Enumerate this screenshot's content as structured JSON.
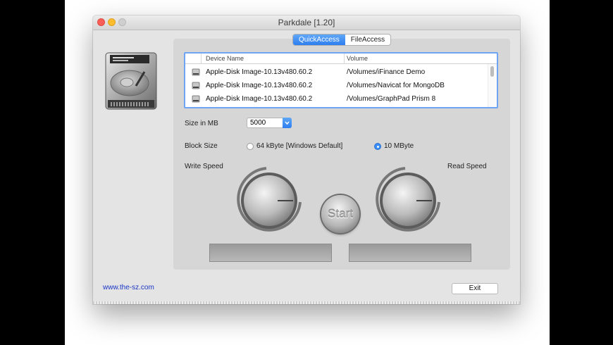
{
  "window": {
    "title": "Parkdale [1.20]",
    "tabs": [
      {
        "label": "QuickAccess",
        "active": true
      },
      {
        "label": "FileAccess",
        "active": false
      }
    ]
  },
  "devices": {
    "columns": [
      "Device Name",
      "Volume"
    ],
    "rows": [
      {
        "name": "Apple-Disk Image-10.13v480.60.2",
        "volume": "/Volumes/iFinance Demo"
      },
      {
        "name": "Apple-Disk Image-10.13v480.60.2",
        "volume": "/Volumes/Navicat for MongoDB"
      },
      {
        "name": "Apple-Disk Image-10.13v480.60.2",
        "volume": "/Volumes/GraphPad Prism 8"
      }
    ]
  },
  "size": {
    "label": "Size in MB",
    "value": "5000"
  },
  "block_size": {
    "label": "Block Size",
    "options": [
      {
        "label": "64 kByte [Windows Default]",
        "selected": false
      },
      {
        "label": "10 MByte",
        "selected": true
      }
    ]
  },
  "speed": {
    "write_label": "Write Speed",
    "read_label": "Read Speed"
  },
  "start_label": "Start",
  "footer": {
    "link": "www.the-sz.com",
    "exit_label": "Exit"
  },
  "colors": {
    "accent": "#2d7ef0",
    "link": "#1a36c6"
  },
  "icons": [
    "hard-disk-icon",
    "drive-row-icon",
    "chevron-down-icon"
  ]
}
